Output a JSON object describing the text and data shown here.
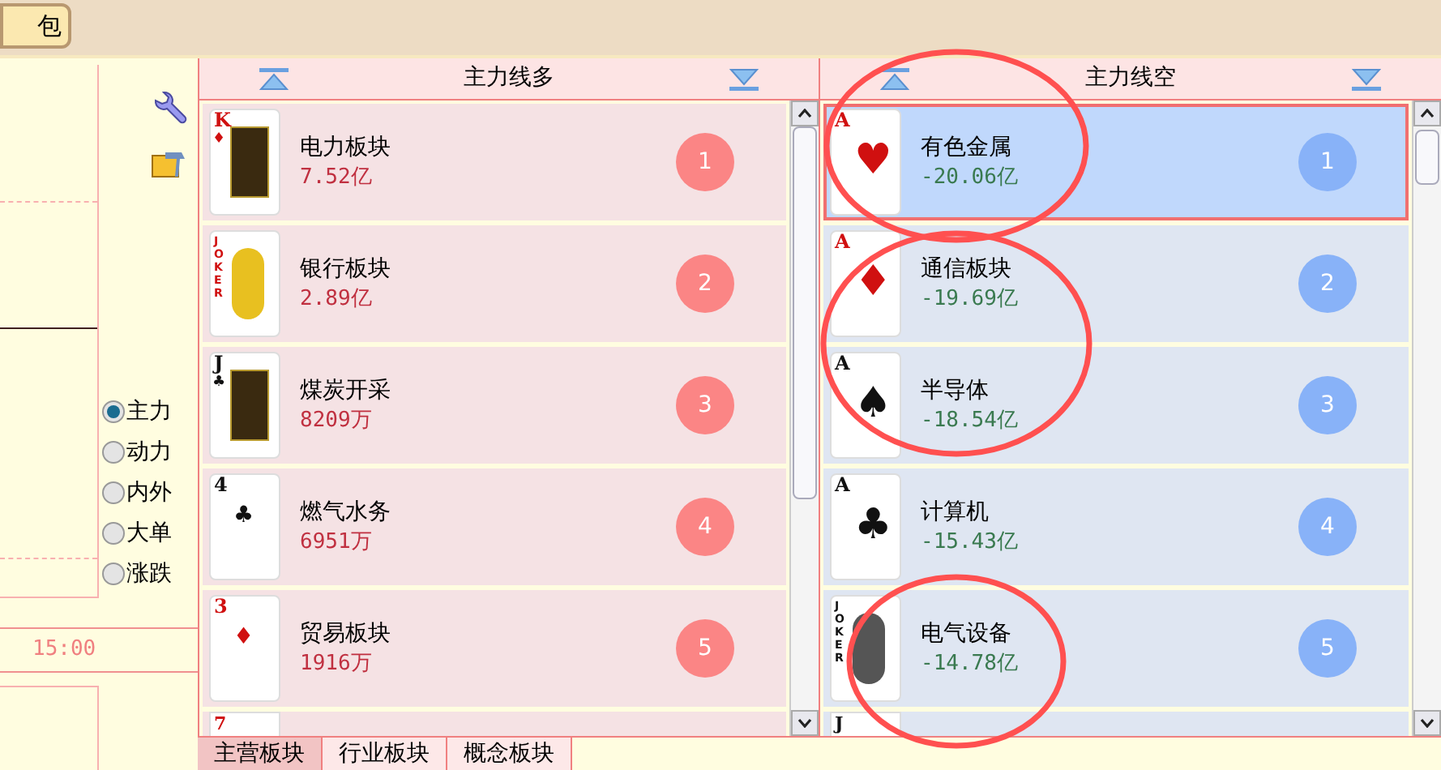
{
  "top_tab": {
    "label": "包"
  },
  "tools": {
    "radios": [
      {
        "label": "主力",
        "selected": true
      },
      {
        "label": "动力",
        "selected": false
      },
      {
        "label": "内外",
        "selected": false
      },
      {
        "label": "大单",
        "selected": false
      },
      {
        "label": "涨跌",
        "selected": false
      }
    ],
    "time_label": "15:00"
  },
  "long_panel": {
    "title": "主力线多",
    "rows": [
      {
        "rank": "K",
        "suit": "♦",
        "color": "#d01010",
        "kind": "face",
        "name": "电力板块",
        "amount": "7.52亿",
        "badge": "1",
        "selected": false
      },
      {
        "rank": "JOKER",
        "suit": "",
        "color": "#d01010",
        "kind": "joker",
        "name": "银行板块",
        "amount": "2.89亿",
        "badge": "2",
        "selected": false
      },
      {
        "rank": "J",
        "suit": "♣",
        "color": "#111111",
        "kind": "face",
        "name": "煤炭开采",
        "amount": "8209万",
        "badge": "3",
        "selected": false
      },
      {
        "rank": "4",
        "suit": "♣",
        "color": "#111111",
        "kind": "pip",
        "name": "燃气水务",
        "amount": "6951万",
        "badge": "4",
        "selected": false
      },
      {
        "rank": "3",
        "suit": "♦",
        "color": "#d01010",
        "kind": "pip",
        "name": "贸易板块",
        "amount": "1916万",
        "badge": "5",
        "selected": false
      }
    ],
    "partial_card": {
      "rank": "7",
      "color": "#d01010"
    }
  },
  "short_panel": {
    "title": "主力线空",
    "rows": [
      {
        "rank": "A",
        "suit": "♥",
        "color": "#d01010",
        "kind": "ace",
        "name": "有色金属",
        "amount": "-20.06亿",
        "badge": "1",
        "selected": true
      },
      {
        "rank": "A",
        "suit": "♦",
        "color": "#d01010",
        "kind": "ace",
        "name": "通信板块",
        "amount": "-19.69亿",
        "badge": "2",
        "selected": false
      },
      {
        "rank": "A",
        "suit": "♠",
        "color": "#111111",
        "kind": "ace",
        "name": "半导体",
        "amount": "-18.54亿",
        "badge": "3",
        "selected": false
      },
      {
        "rank": "A",
        "suit": "♣",
        "color": "#111111",
        "kind": "ace",
        "name": "计算机",
        "amount": "-15.43亿",
        "badge": "4",
        "selected": false
      },
      {
        "rank": "JOKER",
        "suit": "",
        "color": "#111111",
        "kind": "joker",
        "name": "电气设备",
        "amount": "-14.78亿",
        "badge": "5",
        "selected": false
      }
    ],
    "partial_card": {
      "rank": "J",
      "color": "#111111"
    }
  },
  "bottom_tabs": [
    {
      "label": "主营板块",
      "selected": true
    },
    {
      "label": "行业板块",
      "selected": false
    },
    {
      "label": "概念板块",
      "selected": false
    }
  ]
}
